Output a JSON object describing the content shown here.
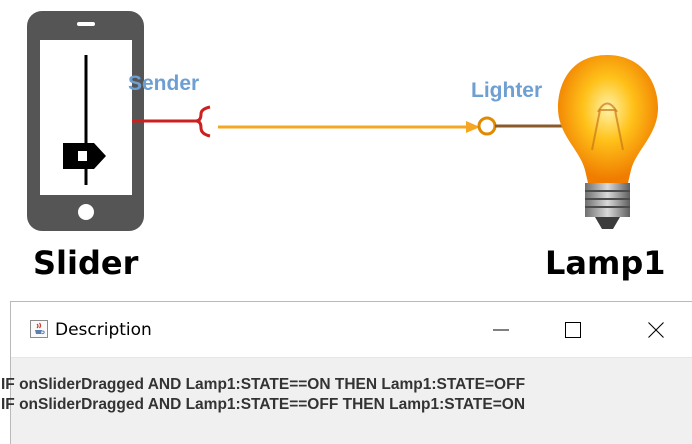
{
  "diagram": {
    "nodes": [
      {
        "name": "Slider",
        "icon": "smartphone-slider-icon"
      },
      {
        "name": "Lamp1",
        "icon": "light-bulb-icon"
      }
    ],
    "ports": {
      "sender": "Sender",
      "lighter": "Lighter"
    },
    "colors": {
      "connection": "#f5a623",
      "port_label": "#6e9fd3",
      "sender_wire": "#cc1f1f",
      "lighter_wire": "#8b5a2b"
    }
  },
  "window": {
    "title": "Description",
    "app_icon": "java-cup-icon",
    "controls": {
      "minimize": "minimize-icon",
      "maximize": "maximize-icon",
      "close": "close-icon"
    },
    "rules": [
      "IF onSliderDragged AND Lamp1:STATE==ON THEN Lamp1:STATE=OFF",
      "IF onSliderDragged AND Lamp1:STATE==OFF THEN Lamp1:STATE=ON"
    ]
  }
}
